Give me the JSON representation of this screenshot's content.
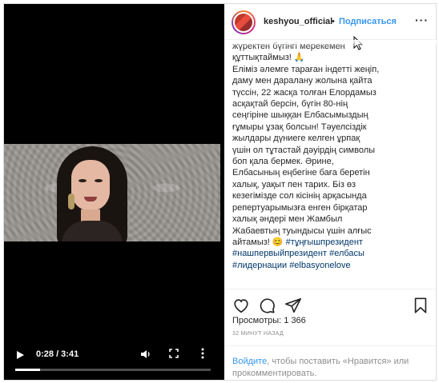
{
  "video": {
    "time_display": "0:28 / 3:41",
    "progress": 0.127,
    "controls": {
      "play": "play-icon",
      "volume": "volume-icon",
      "fullscreen": "fullscreen-icon",
      "more": "more-vertical-icon"
    }
  },
  "header": {
    "username": "keshyou_official",
    "separator": "•",
    "follow_label": "Подписаться",
    "options_label": "···"
  },
  "caption": {
    "lines": [
      "жүректен бүгінгі мерекемен",
      "құттықтаймыз! 🙏",
      "Еліміз әлемге тараған індетті жеңіп,",
      "даму мен даралану жолына қайта",
      "түссін, 22 жасқа толған Елордамыз",
      "асқақтай берсін, бүгін 80-нің",
      "сеңгіріне шыққан Елбасымыздың",
      "ғұмыры ұзақ болсын! Тәуелсіздік",
      "жылдары дүниеге келген ұрпақ",
      "үшін ол тұтастай дәуірдің символы",
      "боп қала бермек. Әрине,",
      "Елбасының еңбегіне баға беретін",
      "халық, уақыт пен тарих. Біз өз",
      "кезегімізде сол кісінің арқасында",
      "репертуарымызға енген бірқатар",
      "халық әндері мен Жамбыл",
      "Жабаевтың туындысы үшін алғыс"
    ],
    "last_line_text": "айтамыз! 😊 ",
    "hashtags": [
      "#тұңғышпрезидент",
      "#нашпервыйпрезидент",
      "#елбасы",
      "#лидернации",
      "#elbasyonelove"
    ]
  },
  "actions": {
    "like": "heart-icon",
    "comment": "comment-icon",
    "share": "share-icon",
    "save": "bookmark-icon"
  },
  "stats": {
    "views_label": "Просмотры:",
    "views_count": "1 366",
    "time_ago": "32 МИНУТ НАЗАД"
  },
  "login_prompt": {
    "link": "Войдите",
    "text": ", чтобы поставить «Нравится» или прокомментировать."
  },
  "colors": {
    "link_blue": "#3897f0",
    "hashtag_blue": "#00376b",
    "muted": "#8e8e8e",
    "border": "#dbdbdb"
  }
}
